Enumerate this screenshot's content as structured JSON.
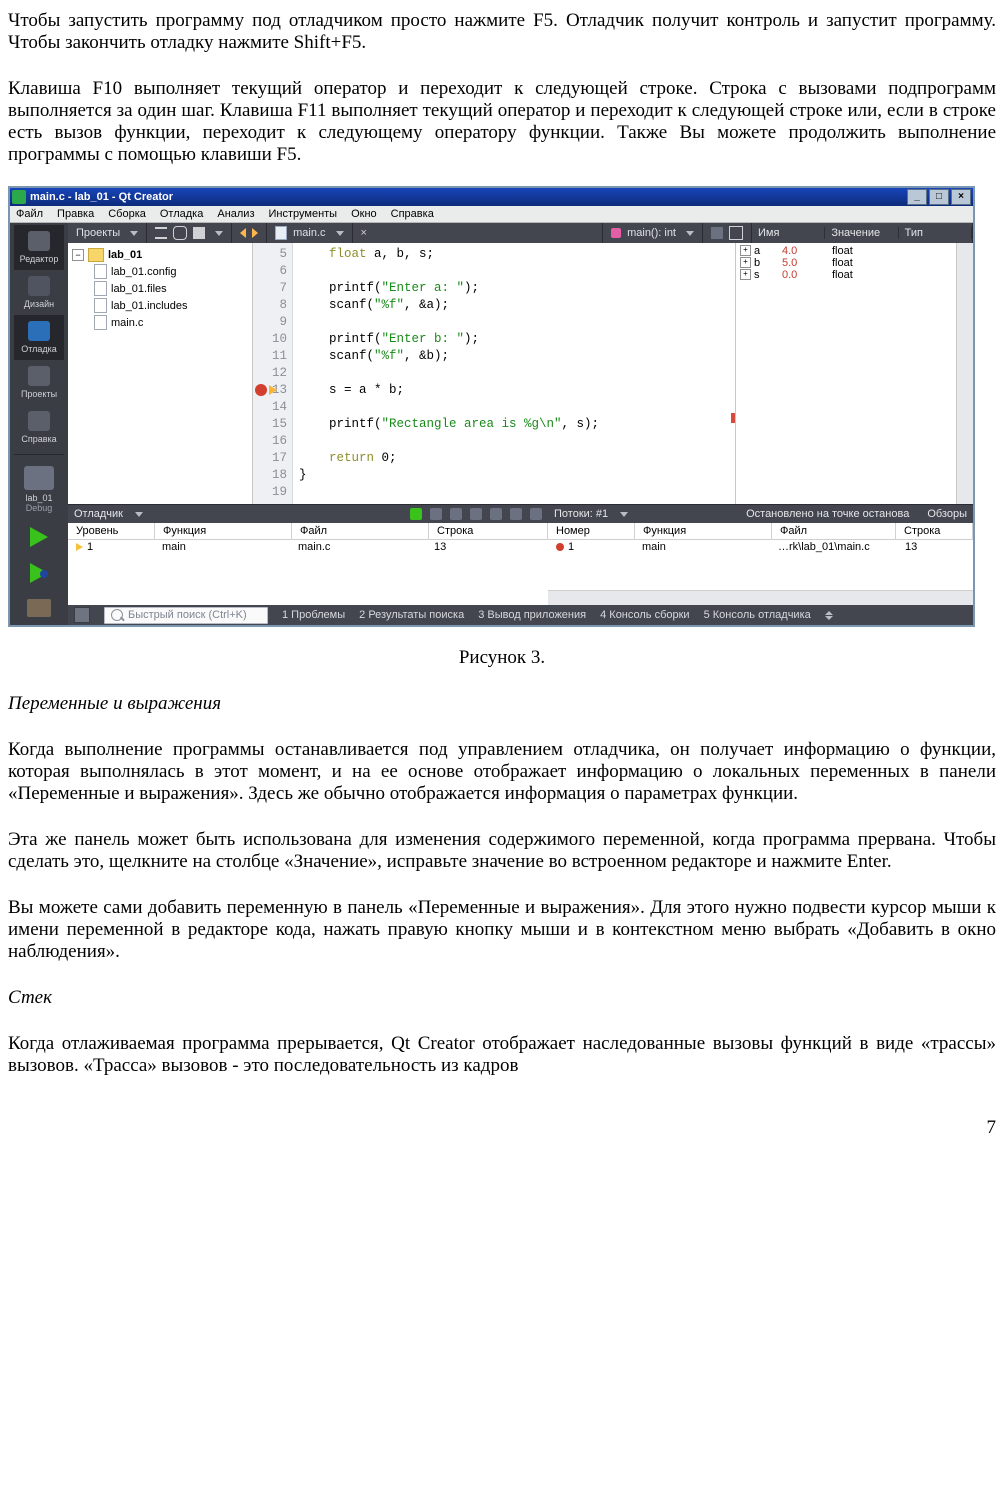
{
  "para1": "Чтобы запустить программу под отладчиком просто нажмите F5. Отладчик получит контроль и запустит программу. Чтобы закончить отладку нажмите Shift+F5.",
  "para2": "Клавиша F10 выполняет текущий оператор и переходит к следующей строке. Строка с вызовами подпрограмм выполняется за один шаг. Клавиша F11 выполняет текущий оператор и переходит к следующей строке или, если в строке есть вызов функции, переходит к следующему оператору функции. Также Вы можете продолжить выполнение программы с помощью клавиши F5.",
  "caption": "Рисунок 3.",
  "h1": "Переменные и выражения",
  "para3": "Когда выполнение программы останавливается под управлением отладчика, он получает информацию о функции, которая выполнялась в этот момент, и на ее основе отображает информацию о локальных переменных в панели «Переменные и выражения». Здесь же обычно отображается информация о параметрах функции.",
  "para4": "Эта же панель может быть использована для изменения содержимого переменной, когда программа прервана. Чтобы сделать это, щелкните на столбце «Значение», исправьте значение во встроенном редакторе и нажмите Enter.",
  "para5": "Вы можете сами добавить переменную в панель «Переменные и выражения». Для этого нужно подвести курсор мыши к имени переменной в редакторе кода, нажать правую кнопку мыши и в контекстном меню выбрать «Добавить в окно наблюдения».",
  "h2": "Стек",
  "para6": "Когда отлаживаемая программа прерывается, Qt Creator отображает наследованные вызовы функций в виде «трассы» вызовов. «Трасса» вызовов - это последовательность из кадров",
  "page_num": "7",
  "screenshot": {
    "title": "main.c - lab_01 - Qt Creator",
    "menu": [
      "Файл",
      "Правка",
      "Сборка",
      "Отладка",
      "Анализ",
      "Инструменты",
      "Окно",
      "Справка"
    ],
    "rail": {
      "projects_label": "Редактор",
      "design": "Дизайн",
      "debug": "Отладка",
      "proj": "Проекты",
      "help": "Справка",
      "kit": "lab_01",
      "kit2": "Debug"
    },
    "toolbar": {
      "projects": "Проекты",
      "file": "main.c",
      "func": "main(): int"
    },
    "tree": {
      "root": "lab_01",
      "files": [
        "lab_01.config",
        "lab_01.files",
        "lab_01.includes",
        "main.c"
      ]
    },
    "gutter": [
      "5",
      "6",
      "7",
      "8",
      "9",
      "10",
      "11",
      "12",
      "13",
      "14",
      "15",
      "16",
      "17",
      "18",
      "19"
    ],
    "code": [
      "    float a, b, s;",
      "",
      "    printf(\"Enter a: \");",
      "    scanf(\"%f\", &a);",
      "",
      "    printf(\"Enter b: \");",
      "    scanf(\"%f\", &b);",
      "",
      "    s = a * b;",
      "",
      "    printf(\"Rectangle area is %g\\n\", s);",
      "",
      "    return 0;",
      "}",
      ""
    ],
    "vars": {
      "cols": [
        "Имя",
        "Значение",
        "Тип"
      ],
      "rows": [
        {
          "n": "a",
          "v": "4.0",
          "t": "float"
        },
        {
          "n": "b",
          "v": "5.0",
          "t": "float"
        },
        {
          "n": "s",
          "v": "0.0",
          "t": "float"
        }
      ]
    },
    "dbgL": {
      "title": "Отладчик",
      "cols": [
        "Уровень",
        "Функция",
        "Файл",
        "Строка"
      ],
      "row": {
        "lvl": "1",
        "fn": "main",
        "file": "main.c",
        "ln": "13"
      }
    },
    "dbgR": {
      "threads": "Потоки: #1",
      "status": "Остановлено на точке останова",
      "obz": "Обзоры",
      "cols": [
        "Номер",
        "Функция",
        "Файл",
        "Строка"
      ],
      "row": {
        "n": "1",
        "fn": "main",
        "file": "…rk\\lab_01\\main.c",
        "ln": "13"
      }
    },
    "bottom": {
      "search": "Быстрый поиск (Ctrl+K)",
      "items": [
        "1   Проблемы",
        "2   Результаты поиска",
        "3   Вывод приложения",
        "4   Консоль сборки",
        "5   Консоль отладчика"
      ]
    }
  }
}
